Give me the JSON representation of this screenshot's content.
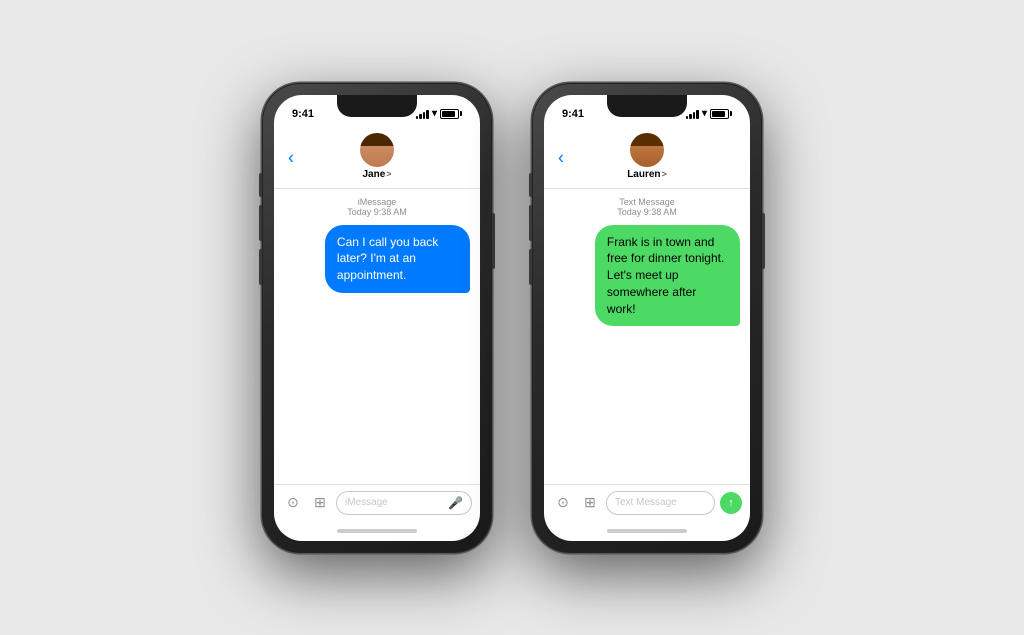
{
  "phone1": {
    "time": "9:41",
    "contact": "Jane",
    "chevron": ">",
    "message_type": "iMessage",
    "message_date": "Today 9:38 AM",
    "bubble_text": "Can I call you back later? I'm at an appointment.",
    "bubble_color": "blue",
    "input_placeholder": "iMessage",
    "back_label": "‹"
  },
  "phone2": {
    "time": "9:41",
    "contact": "Lauren",
    "chevron": ">",
    "message_type": "Text Message",
    "message_date": "Today 9:38 AM",
    "bubble_text": "Frank is in town and free for dinner tonight. Let's meet up somewhere after work!",
    "bubble_color": "green",
    "input_placeholder": "Text Message",
    "back_label": "‹"
  }
}
